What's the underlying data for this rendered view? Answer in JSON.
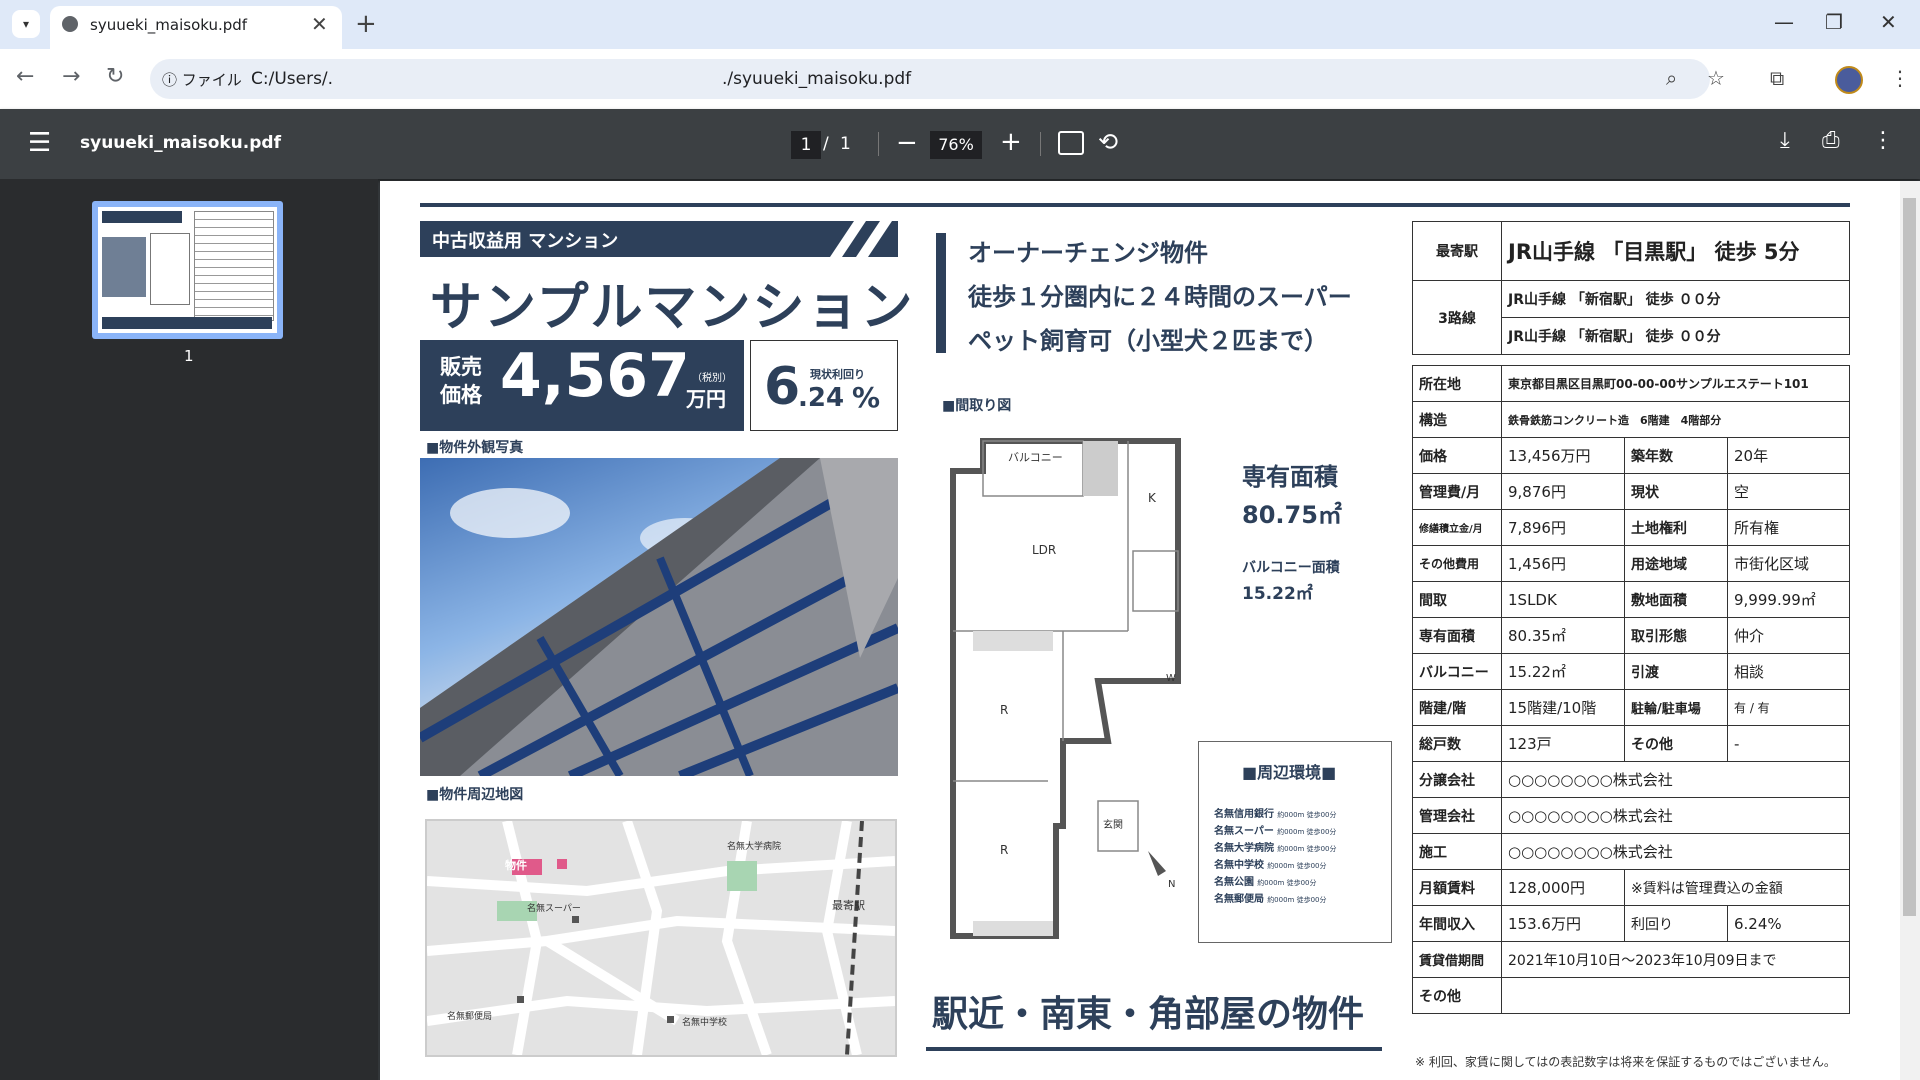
{
  "browser": {
    "tab_title": "syuueki_maisoku.pdf",
    "address_scheme": "ファイル",
    "address_path": "C:/Users/.",
    "address_file": "./syuueki_maisoku.pdf"
  },
  "viewer": {
    "file_name": "syuueki_maisoku.pdf",
    "page_current": "1",
    "page_separator": "/",
    "page_total": "1",
    "zoom": "76%",
    "thumb_page_label": "1"
  },
  "flyer": {
    "category": "中古収益用 マンション",
    "name": "サンプルマンション",
    "price_label_1": "販売",
    "price_label_2": "価格",
    "price_value": "4,567",
    "price_tax": "（税別）",
    "price_unit": "万円",
    "yield_label": "現状利回り",
    "yield_int": "6",
    "yield_dec": ".24",
    "yield_pct": "%",
    "photo_heading": "■物件外観写真",
    "map_heading": "■物件周辺地図",
    "headline_1": "オーナーチェンジ物件",
    "headline_2": "徒歩１分圏内に２４時間のスーパー",
    "headline_3": "ペット飼育可（小型犬２匹まで）",
    "floorplan_heading": "■間取り図",
    "area_label": "専有面積",
    "area_value": "80.75㎡",
    "balcony_label": "バルコニー面積",
    "balcony_value": "15.22㎡",
    "environs_heading": "■周辺環境■",
    "environs": [
      {
        "name": "名無信用銀行",
        "dist": "約000m 徒歩00分"
      },
      {
        "name": "名無スーパー",
        "dist": "約000m 徒歩00分"
      },
      {
        "name": "名無大学病院",
        "dist": "約000m 徒歩00分"
      },
      {
        "name": "名無中学校",
        "dist": "約000m 徒歩00分"
      },
      {
        "name": "名無公園",
        "dist": "約000m 徒歩00分"
      },
      {
        "name": "名無郵便局",
        "dist": "約000m 徒歩00分"
      }
    ],
    "slogan": "駅近・南東・角部屋の物件",
    "plan_labels": {
      "balcony": "バルコニー",
      "k": "K",
      "ldr": "LDR",
      "r1": "R",
      "r2": "R",
      "entrance": "玄関",
      "w": "W",
      "n": "N"
    },
    "map_labels": {
      "property": "物件",
      "hospital": "名無大学病院",
      "supermarket": "名無スーパー",
      "station": "最寄駅",
      "post_office": "名無郵便局",
      "school": "名無中学校"
    },
    "station": {
      "nearest_label": "最寄駅",
      "nearest_value": "JR山手線 「目黒駅」 徒歩 5分",
      "lines_label": "3路線",
      "line_1": "JR山手線 「新宿駅」 徒歩 ００分",
      "line_2": "JR山手線 「新宿駅」 徒歩 ００分"
    },
    "specs": {
      "address_label": "所在地",
      "address": "東京都目黒区目黒町00-00-00サンプルエステート101",
      "structure_label": "構造",
      "structure": "鉄骨鉄筋コンクリート造　6階建　4階部分",
      "price_label": "価格",
      "price": "13,456万円",
      "age_label": "築年数",
      "age": "20年",
      "mgmt_fee_label": "管理費/月",
      "mgmt_fee": "9,876円",
      "status_label": "現状",
      "status": "空",
      "repair_label": "修繕積立金/月",
      "repair": "7,896円",
      "land_right_label": "土地権利",
      "land_right": "所有権",
      "other_fee_label": "その他費用",
      "other_fee": "1,456円",
      "zone_label": "用途地域",
      "zone": "市街化区域",
      "layout_label": "間取",
      "layout": "1SLDK",
      "site_area_label": "敷地面積",
      "site_area": "9,999.99㎡",
      "exclusive_label": "専有面積",
      "exclusive": "80.35㎡",
      "trade_label": "取引形態",
      "trade": "仲介",
      "balcony_label": "バルコニー",
      "balcony": "15.22㎡",
      "handover_label": "引渡",
      "handover": "相談",
      "floors_label": "階建/階",
      "floors": "15階建/10階",
      "parking_label": "駐輪/駐車場",
      "parking": "有 / 有",
      "units_label": "総戸数",
      "units": "123戸",
      "other_label": "その他",
      "other": "-",
      "seller_label": "分譲会社",
      "seller": "○○○○○○○○株式会社",
      "manager_label": "管理会社",
      "manager": "○○○○○○○○株式会社",
      "builder_label": "施工",
      "builder": "○○○○○○○○株式会社",
      "rent_label": "月額賃料",
      "rent": "128,000円",
      "rent_note": "※賃料は管理費込の金額",
      "income_label": "年間収入",
      "income": "153.6万円",
      "yield_label": "利回り",
      "yield": "6.24%",
      "lease_label": "賃貸借期間",
      "lease": "2021年10月10日～2023年10月09日まで",
      "misc_label": "その他",
      "misc": ""
    },
    "disclaimer": "※ 利回、家賃に関してはの表記数字は将来を保証するものではございません。"
  }
}
